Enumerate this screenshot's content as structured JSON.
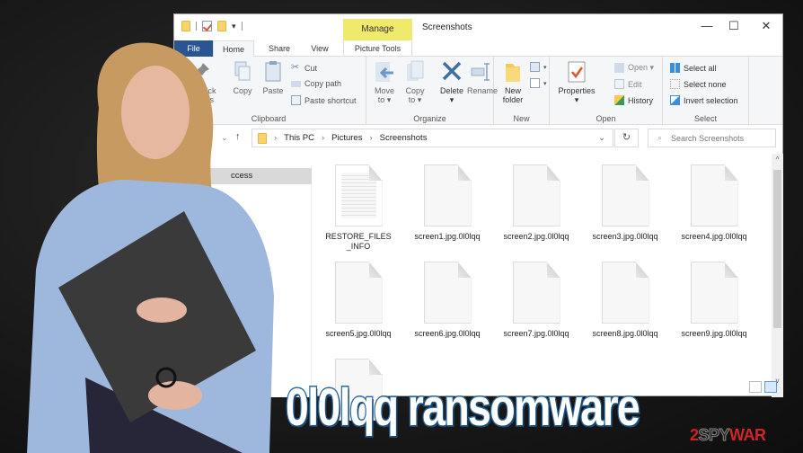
{
  "window": {
    "title": "Screenshots",
    "contextual_tab_group": "Manage",
    "controls": {
      "minimize": "—",
      "maximize": "☐",
      "close": "✕"
    },
    "help": "?"
  },
  "tabs": [
    {
      "label": "File"
    },
    {
      "label": "Home"
    },
    {
      "label": "Share"
    },
    {
      "label": "View"
    },
    {
      "label": "Picture Tools"
    }
  ],
  "ribbon": {
    "clipboard": {
      "label": "Clipboard",
      "pin": "to Quick\naccess",
      "pin_line1": "to Quick",
      "pin_line2": "access",
      "copy": "Copy",
      "paste": "Paste",
      "cut": "Cut",
      "copy_path": "Copy path",
      "paste_shortcut": "Paste shortcut"
    },
    "organize": {
      "label": "Organize",
      "move_to_1": "Move",
      "move_to_2": "to ▾",
      "copy_to_1": "Copy",
      "copy_to_2": "to ▾",
      "delete": "Delete",
      "delete_arrow": "▾",
      "rename": "Rename"
    },
    "new": {
      "label": "New",
      "new_folder_1": "New",
      "new_folder_2": "folder"
    },
    "open": {
      "label": "Open",
      "properties": "Properties",
      "properties_arrow": "▾",
      "open": "Open ▾",
      "edit": "Edit",
      "history": "History"
    },
    "select": {
      "label": "Select",
      "select_all": "Select all",
      "select_none": "Select none",
      "invert": "Invert selection"
    }
  },
  "navigation": {
    "back": "←",
    "forward": "→",
    "recent": "⌄",
    "up": "↑",
    "breadcrumb": [
      "This PC",
      "Pictures",
      "Screenshots"
    ],
    "separator": "›",
    "dropdown": "⌄",
    "refresh": "↻",
    "search_placeholder": "Search Screenshots"
  },
  "sidebar": {
    "items": [
      {
        "label": "ccess"
      }
    ]
  },
  "files": [
    {
      "name": "RESTORE_FILES_INFO",
      "type": "text"
    },
    {
      "name": "screen1.jpg.0l0lqq",
      "type": "blank"
    },
    {
      "name": "screen2.jpg.0l0lqq",
      "type": "blank"
    },
    {
      "name": "screen3.jpg.0l0lqq",
      "type": "blank"
    },
    {
      "name": "screen4.jpg.0l0lqq",
      "type": "blank"
    },
    {
      "name": "screen5.jpg.0l0lqq",
      "type": "blank"
    },
    {
      "name": "screen6.jpg.0l0lqq",
      "type": "blank"
    },
    {
      "name": "screen7.jpg.0l0lqq",
      "type": "blank"
    },
    {
      "name": "screen8.jpg.0l0lqq",
      "type": "blank"
    },
    {
      "name": "screen9.jpg.0l0lqq",
      "type": "blank"
    },
    {
      "name": "",
      "type": "blank"
    }
  ],
  "overlay": {
    "headline": "0l0lqq ransomware",
    "logo": {
      "two": "2",
      "spy": "SPY",
      "war": "WAR"
    }
  },
  "colors": {
    "file_tab": "#2a5592",
    "manage_tab": "#f0ea6c",
    "headline_stroke": "#2b6aa1",
    "logo_red": "#d0232a"
  }
}
